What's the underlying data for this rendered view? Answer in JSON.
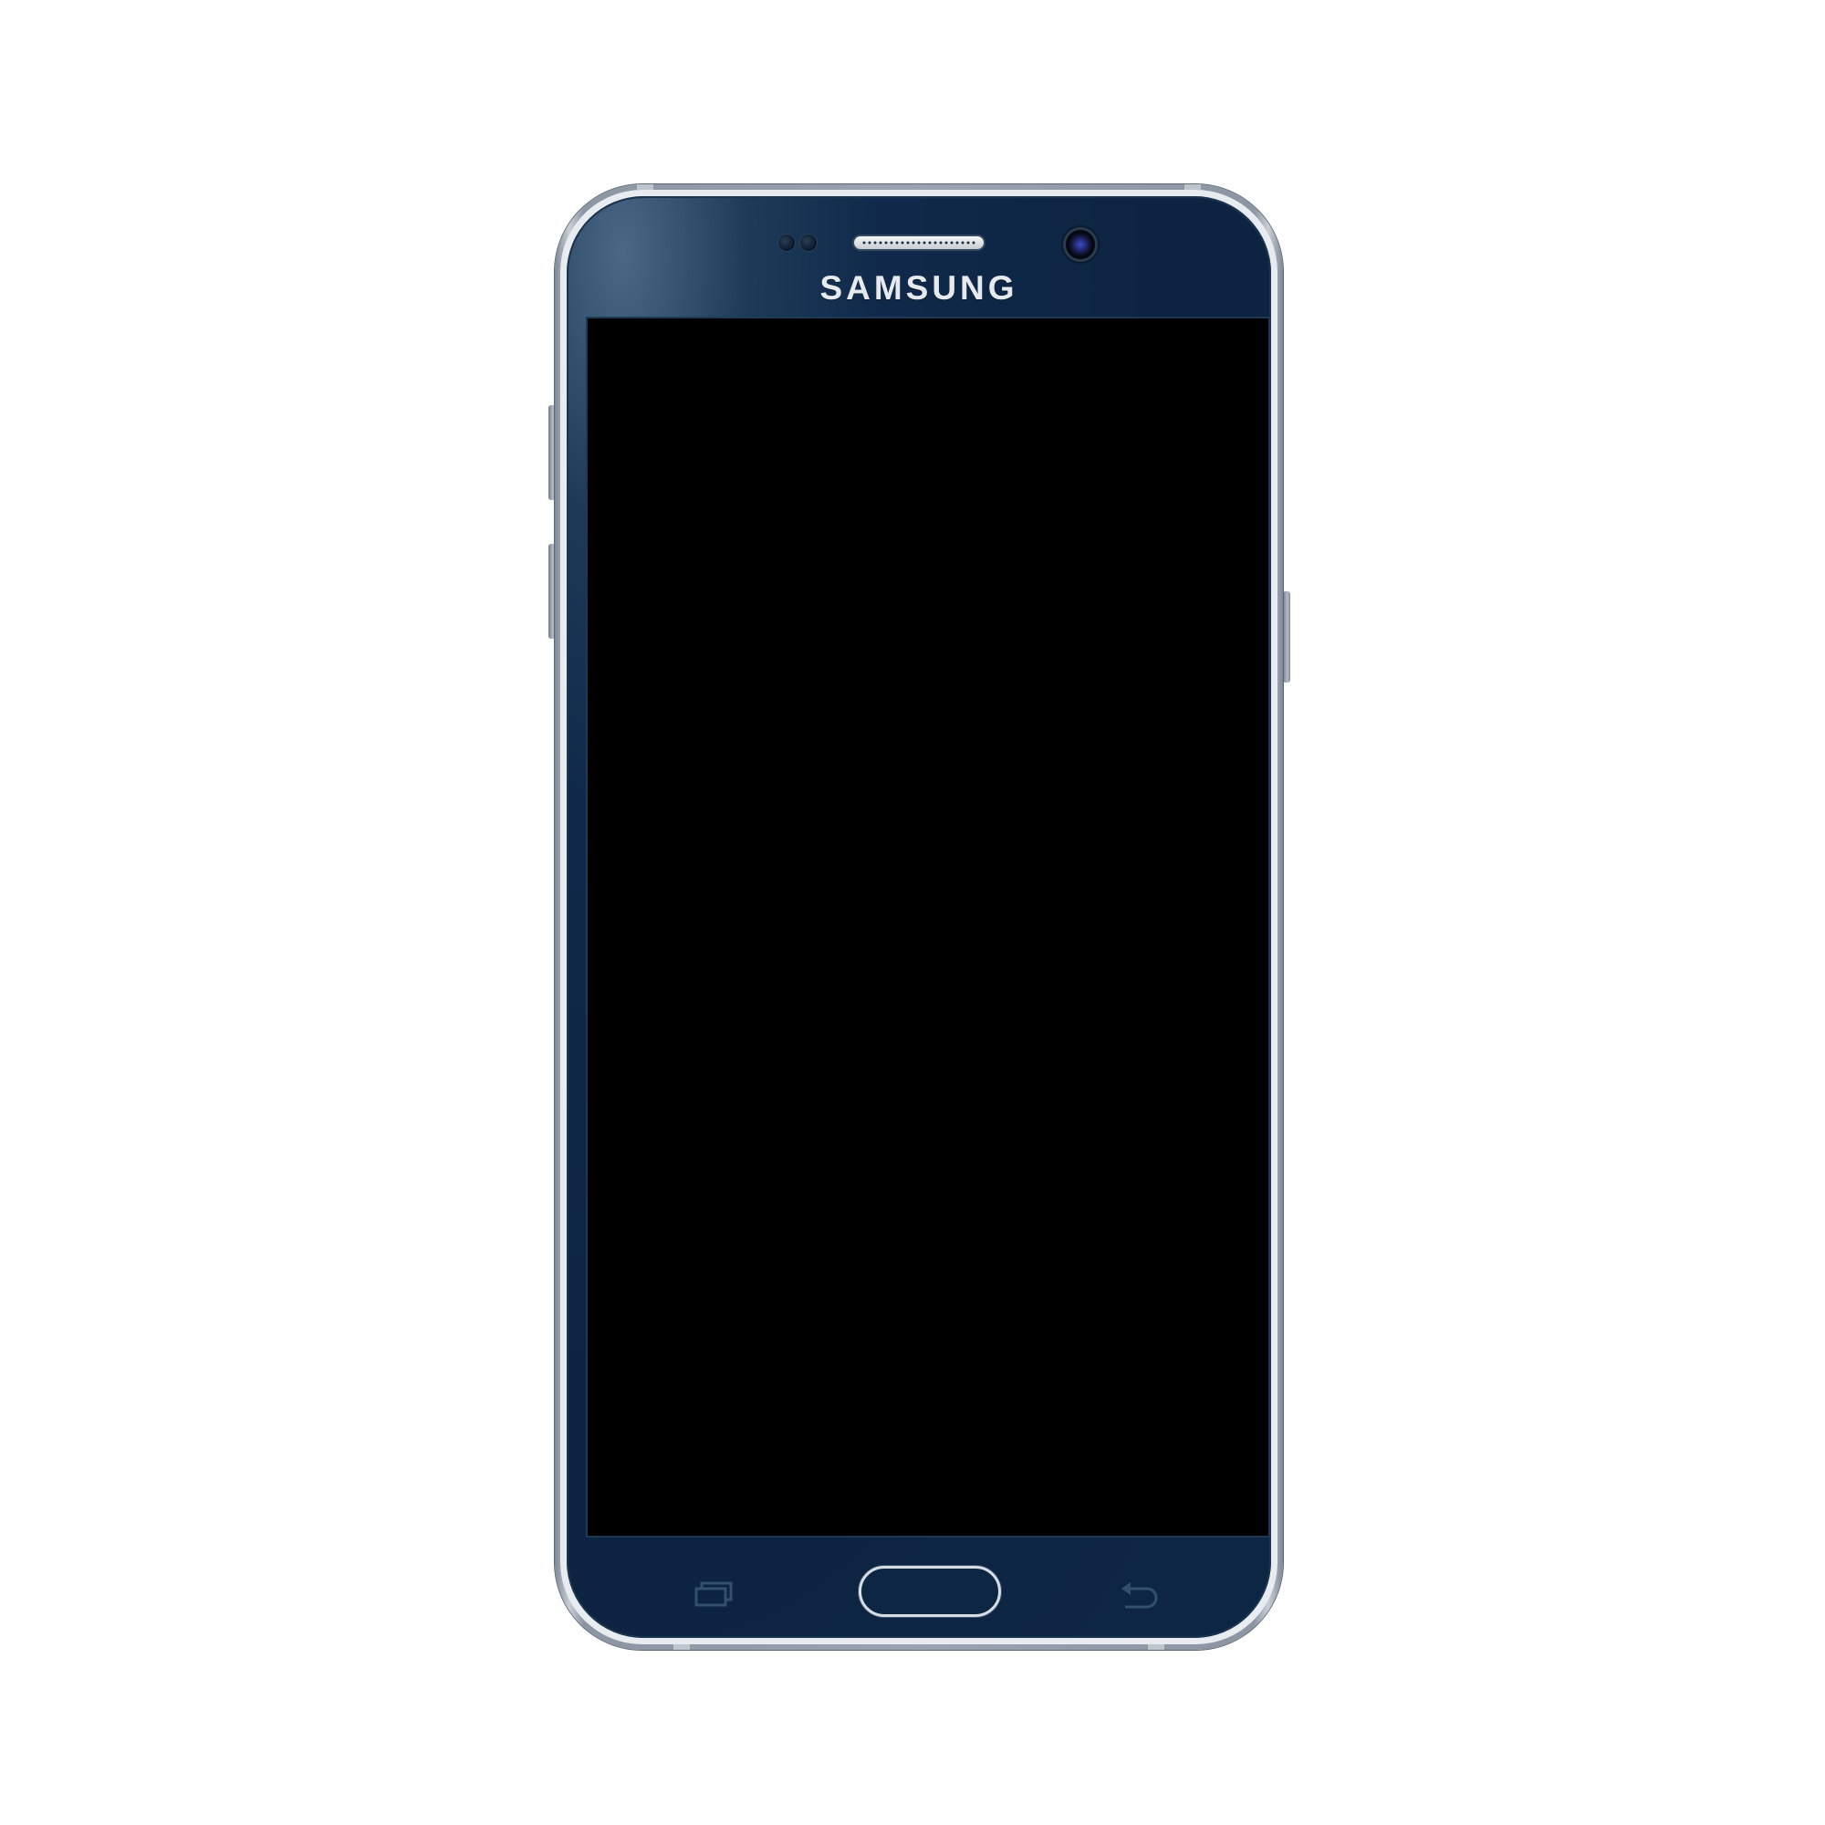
{
  "device": {
    "brand_label": "SAMSUNG",
    "body_color": "#0d2644",
    "frame_color": "#9aa3b0",
    "screen_color": "#000000"
  },
  "navigation_keys": {
    "recent_apps_icon": "recent-apps-icon",
    "home_button_icon": "home-button",
    "back_icon": "back-arrow-icon"
  },
  "side_buttons": {
    "left": [
      "volume-up-button",
      "volume-down-button"
    ],
    "right": [
      "power-button"
    ]
  }
}
